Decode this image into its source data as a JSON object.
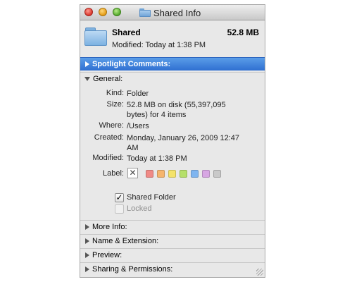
{
  "window": {
    "title": "Shared Info"
  },
  "header": {
    "name": "Shared",
    "size": "52.8 MB",
    "modified": "Modified: Today at 1:38 PM"
  },
  "sections": {
    "spotlight": "Spotlight Comments:",
    "general": "General:",
    "more_info": "More Info:",
    "name_extension": "Name & Extension:",
    "preview": "Preview:",
    "sharing": "Sharing & Permissions:"
  },
  "general": {
    "kind_label": "Kind:",
    "kind_value": "Folder",
    "size_label": "Size:",
    "size_value_line1": "52.8 MB on disk (55,397,095",
    "size_value_line2": "bytes) for 4 items",
    "where_label": "Where:",
    "where_value": "/Users",
    "created_label": "Created:",
    "created_value_line1": "Monday, January 26, 2009 12:47",
    "created_value_line2": "AM",
    "modified_label": "Modified:",
    "modified_value": "Today at 1:38 PM",
    "label_label": "Label:",
    "label_none_glyph": "✕",
    "label_colors": [
      "#f08a86",
      "#f6b56d",
      "#f4e36a",
      "#b6e06a",
      "#7fb5f0",
      "#d7a6e3",
      "#c9c9c9"
    ],
    "shared_folder": {
      "label": "Shared Folder",
      "checked": true,
      "glyph": "✓"
    },
    "locked": {
      "label": "Locked",
      "checked": false
    }
  }
}
